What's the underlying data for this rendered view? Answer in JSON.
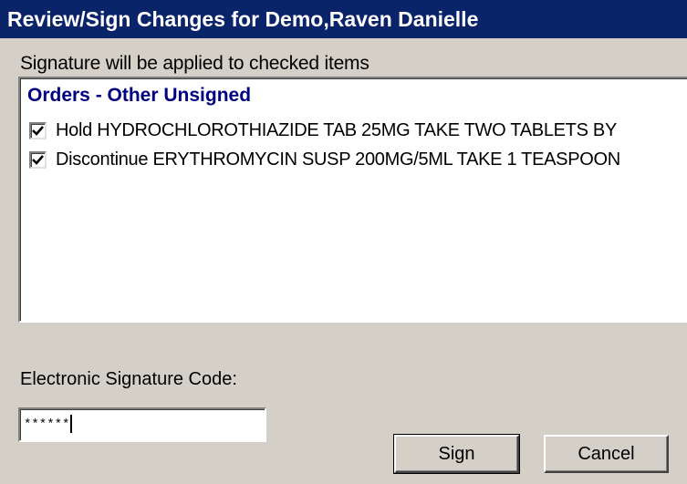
{
  "window": {
    "title": "Review/Sign Changes for Demo,Raven Danielle"
  },
  "caption": "Signature will be applied to checked items",
  "list": {
    "group_header": "Orders - Other Unsigned",
    "items": [
      {
        "checked": true,
        "text": "Hold HYDROCHLOROTHIAZIDE TAB  25MG TAKE TWO TABLETS BY"
      },
      {
        "checked": true,
        "text": "Discontinue ERYTHROMYCIN SUSP  200MG/5ML TAKE 1 TEASPOON"
      }
    ]
  },
  "signature": {
    "label": "Electronic Signature Code:",
    "masked_value": "******"
  },
  "buttons": {
    "sign": "Sign",
    "cancel": "Cancel"
  },
  "colors": {
    "title_bar": "#0a246a",
    "group_header": "#000080",
    "dialog_face": "#d4d0c8"
  }
}
